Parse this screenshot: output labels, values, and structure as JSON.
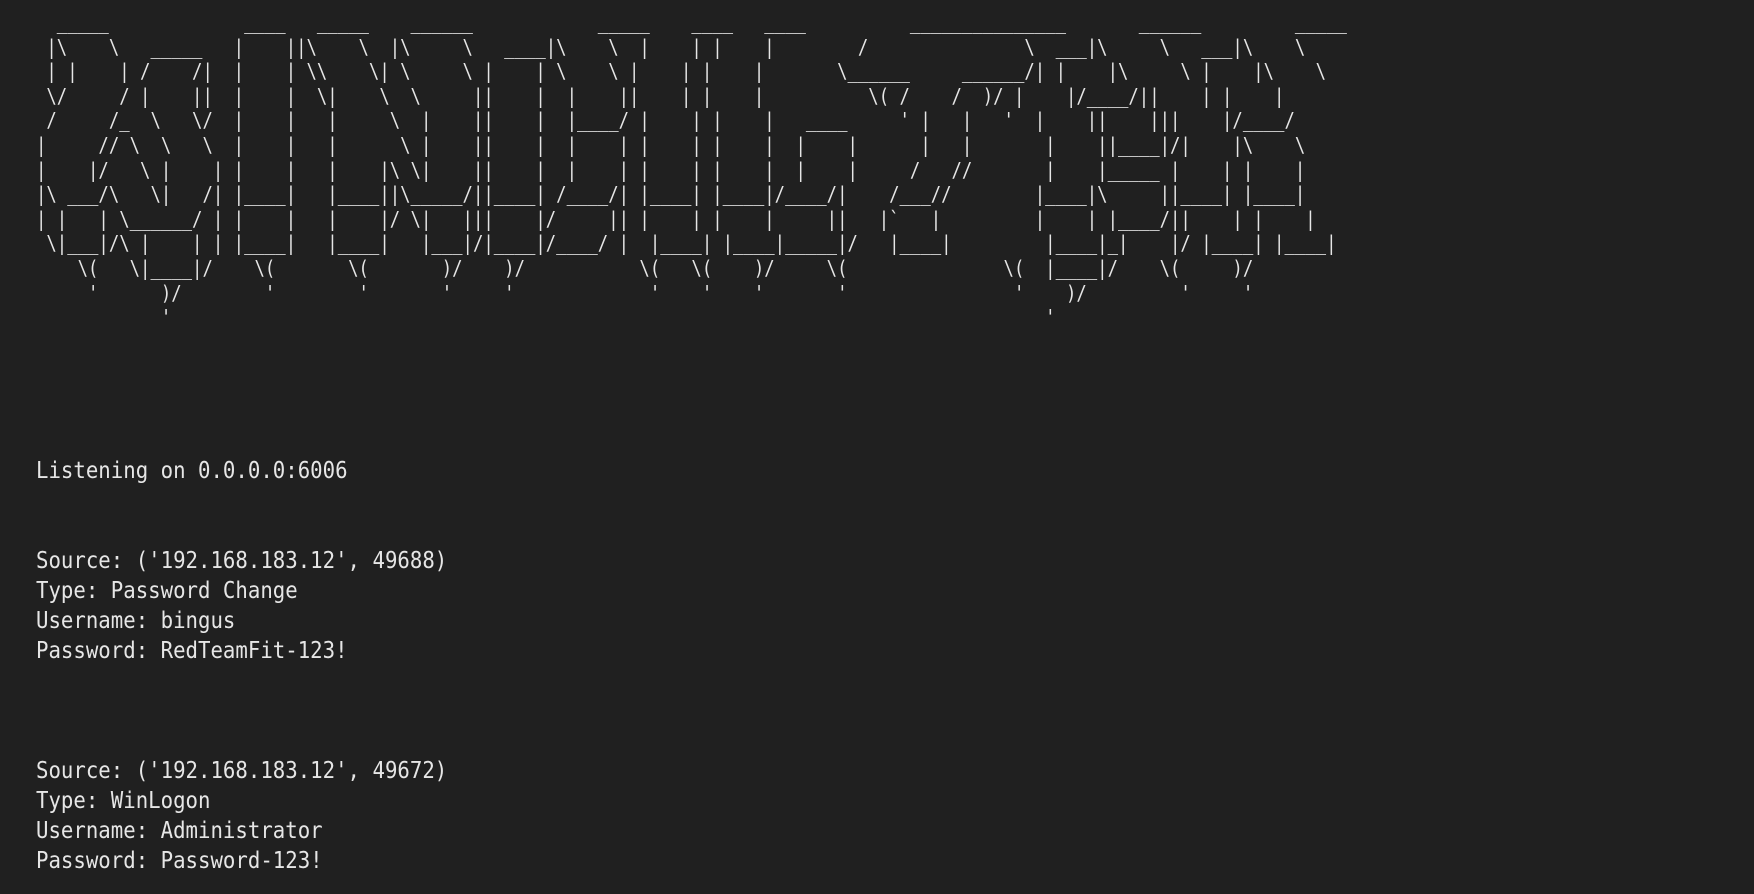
{
  "banner_lines": [
    "  _____             ____   _____    ______            _____    ____   ____          _______________       ______         _____",
    " |\\    \\   _____   |    ||\\    \\  |\\     \\   ____|\\    \\  |    | |    |        /               \\  ___|\\     \\   ___|\\    \\",
    " | |    | /    /|  |    | \\\\    \\| \\     \\ |    | \\    \\ |    | |    |       \\______     ______/| |    |\\     \\ |    |\\    \\",
    " \\/     / |    ||  |    |  \\|    \\  \\     ||    |  |    ||    | |    |          \\( /    /  )/ |    |/____/||    | |    |",
    " /     /_  \\   \\/  |    |   |     \\  |    ||    |  |____/ |    | |    |   ____     ' |   |   '  |    ||    |||    |/____/",
    "|     // \\  \\   \\  |    |   |      \\ |    ||    |  |    | |    | |    |  |    |      |   |       |    ||____|/|    |\\    \\",
    "|    |/   \\ |    | |    |   |    |\\ \\|    ||    |  |    | |    | |    |  |    |     /   //       |    |_____ |    | |    |",
    "|\\ ___/\\   \\|   /| |____|   |____||\\_____/||____| /____/| |____| |____|/____/|    /___//        |____|\\     ||____| |____|",
    "| |   | \\______/ | |    |   |    |/ \\|   |||    |/     || |    | |    |     ||   |`   |         |    | |____/||    | |    |",
    " \\|___|/\\ |    | | |____|   |____|   |___|/|____|/____/ |  |____| |____|_____|/   |____|         |____|_|    |/ |____| |____|",
    "    \\(   \\|____|/    \\(       \\(       )/    )/           \\(   \\(    )/     \\(               \\(  |____|/    \\(     )/",
    "     '      )/        '        '       '     '             '    '    '       '                '    )/         '     '",
    "            '                                                                                    '"
  ],
  "status": {
    "listening": "Listening on 0.0.0.0:6006"
  },
  "entries": [
    {
      "source": "Source: ('192.168.183.12', 49688)",
      "type": "Type: Password Change",
      "username": "Username: bingus",
      "password": "Password: RedTeamFit-123!"
    },
    {
      "source": "Source: ('192.168.183.12', 49672)",
      "type": "Type: WinLogon",
      "username": "Username: Administrator",
      "password": "Password: Password-123!"
    }
  ]
}
